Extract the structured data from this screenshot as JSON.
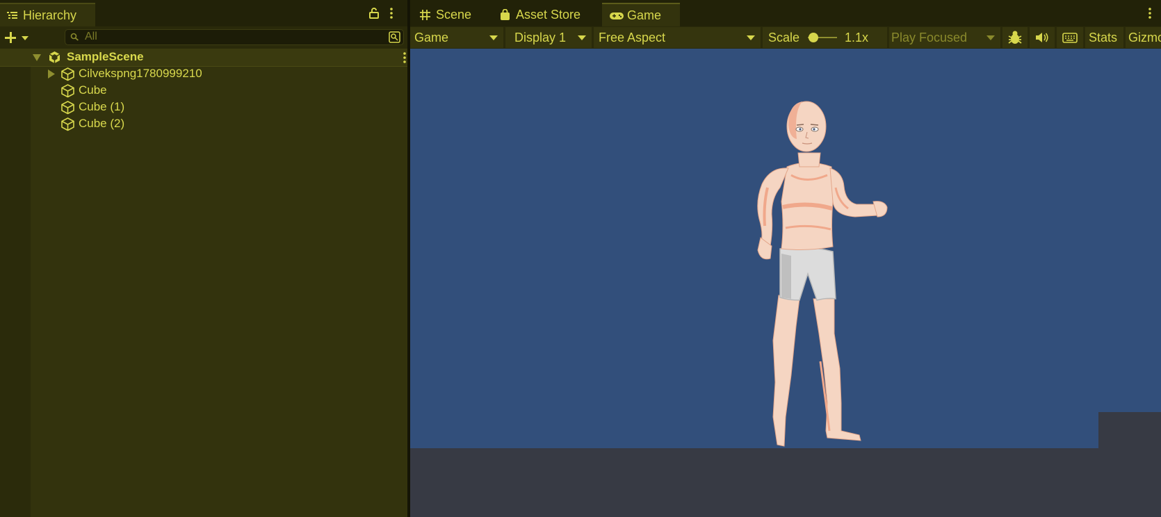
{
  "hierarchy": {
    "tab_label": "Hierarchy",
    "search_placeholder": "All",
    "scene_name": "SampleScene",
    "items": [
      {
        "label": "Cilvekspng1780999210",
        "has_children": true
      },
      {
        "label": "Cube",
        "has_children": false
      },
      {
        "label": "Cube (1)",
        "has_children": false
      },
      {
        "label": "Cube (2)",
        "has_children": false
      }
    ]
  },
  "tabs": [
    {
      "label": "Scene",
      "icon": "grid-icon"
    },
    {
      "label": "Asset Store",
      "icon": "shopping-bag-icon"
    },
    {
      "label": "Game",
      "icon": "gamepad-icon",
      "active": true
    }
  ],
  "game_toolbar": {
    "view_mode": "Game",
    "display": "Display 1",
    "aspect": "Free Aspect",
    "scale_label": "Scale",
    "scale_value": "1.1x",
    "scale_fraction": 0.05,
    "play_mode": "Play Focused",
    "stats_label": "Stats",
    "gizmos_label": "Gizmos"
  },
  "colors": {
    "accent": "#d7d74c",
    "panel": "#33330d",
    "viewport_sky": "#324f7b",
    "ground": "#373a44"
  }
}
